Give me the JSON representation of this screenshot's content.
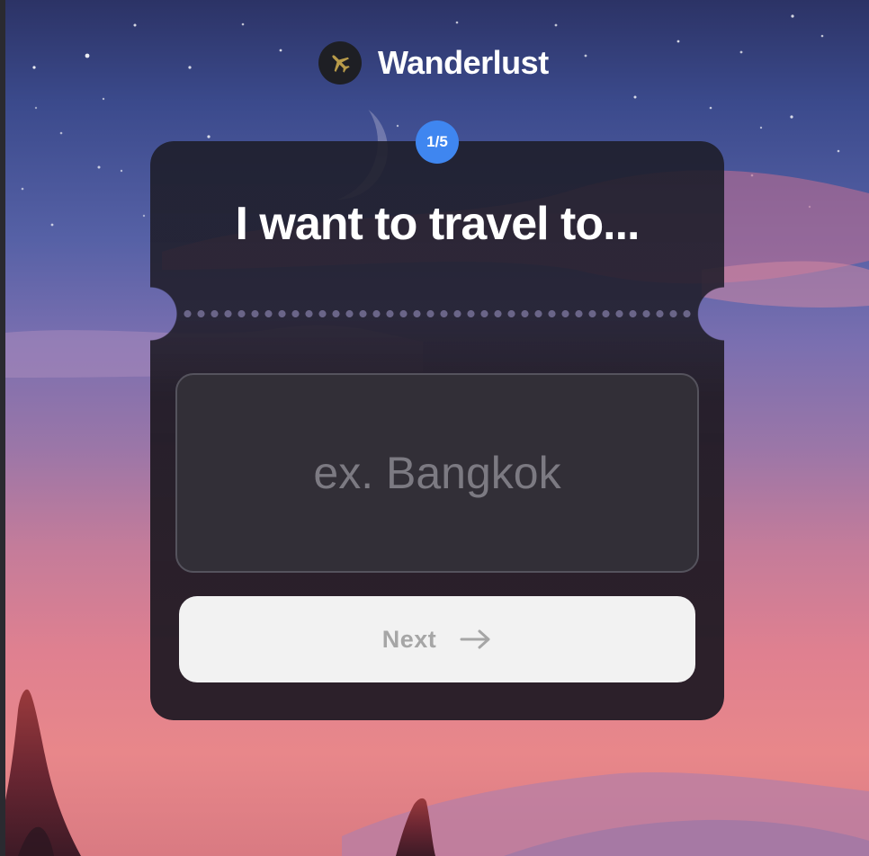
{
  "brand": {
    "name": "Wanderlust",
    "logo_icon": "airplane-icon"
  },
  "step": {
    "label": "1/5",
    "current": 1,
    "total": 5
  },
  "question": {
    "title": "I want to travel to..."
  },
  "destination_input": {
    "placeholder": "ex. Bangkok",
    "value": ""
  },
  "next_button": {
    "label": "Next",
    "icon": "arrow-right-icon"
  },
  "colors": {
    "accent": "#3f86f0",
    "card": "#2a2530",
    "button": "#f2f2f2"
  }
}
